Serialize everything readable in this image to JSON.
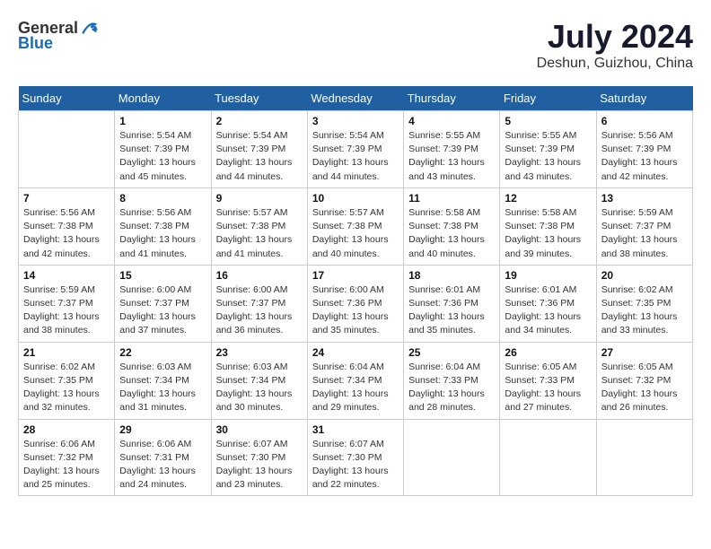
{
  "logo": {
    "text_general": "General",
    "text_blue": "Blue"
  },
  "header": {
    "month_year": "July 2024",
    "location": "Deshun, Guizhou, China"
  },
  "weekdays": [
    "Sunday",
    "Monday",
    "Tuesday",
    "Wednesday",
    "Thursday",
    "Friday",
    "Saturday"
  ],
  "weeks": [
    [
      {
        "day": "",
        "info": ""
      },
      {
        "day": "1",
        "info": "Sunrise: 5:54 AM\nSunset: 7:39 PM\nDaylight: 13 hours\nand 45 minutes."
      },
      {
        "day": "2",
        "info": "Sunrise: 5:54 AM\nSunset: 7:39 PM\nDaylight: 13 hours\nand 44 minutes."
      },
      {
        "day": "3",
        "info": "Sunrise: 5:54 AM\nSunset: 7:39 PM\nDaylight: 13 hours\nand 44 minutes."
      },
      {
        "day": "4",
        "info": "Sunrise: 5:55 AM\nSunset: 7:39 PM\nDaylight: 13 hours\nand 43 minutes."
      },
      {
        "day": "5",
        "info": "Sunrise: 5:55 AM\nSunset: 7:39 PM\nDaylight: 13 hours\nand 43 minutes."
      },
      {
        "day": "6",
        "info": "Sunrise: 5:56 AM\nSunset: 7:39 PM\nDaylight: 13 hours\nand 42 minutes."
      }
    ],
    [
      {
        "day": "7",
        "info": "Sunrise: 5:56 AM\nSunset: 7:38 PM\nDaylight: 13 hours\nand 42 minutes."
      },
      {
        "day": "8",
        "info": "Sunrise: 5:56 AM\nSunset: 7:38 PM\nDaylight: 13 hours\nand 41 minutes."
      },
      {
        "day": "9",
        "info": "Sunrise: 5:57 AM\nSunset: 7:38 PM\nDaylight: 13 hours\nand 41 minutes."
      },
      {
        "day": "10",
        "info": "Sunrise: 5:57 AM\nSunset: 7:38 PM\nDaylight: 13 hours\nand 40 minutes."
      },
      {
        "day": "11",
        "info": "Sunrise: 5:58 AM\nSunset: 7:38 PM\nDaylight: 13 hours\nand 40 minutes."
      },
      {
        "day": "12",
        "info": "Sunrise: 5:58 AM\nSunset: 7:38 PM\nDaylight: 13 hours\nand 39 minutes."
      },
      {
        "day": "13",
        "info": "Sunrise: 5:59 AM\nSunset: 7:37 PM\nDaylight: 13 hours\nand 38 minutes."
      }
    ],
    [
      {
        "day": "14",
        "info": "Sunrise: 5:59 AM\nSunset: 7:37 PM\nDaylight: 13 hours\nand 38 minutes."
      },
      {
        "day": "15",
        "info": "Sunrise: 6:00 AM\nSunset: 7:37 PM\nDaylight: 13 hours\nand 37 minutes."
      },
      {
        "day": "16",
        "info": "Sunrise: 6:00 AM\nSunset: 7:37 PM\nDaylight: 13 hours\nand 36 minutes."
      },
      {
        "day": "17",
        "info": "Sunrise: 6:00 AM\nSunset: 7:36 PM\nDaylight: 13 hours\nand 35 minutes."
      },
      {
        "day": "18",
        "info": "Sunrise: 6:01 AM\nSunset: 7:36 PM\nDaylight: 13 hours\nand 35 minutes."
      },
      {
        "day": "19",
        "info": "Sunrise: 6:01 AM\nSunset: 7:36 PM\nDaylight: 13 hours\nand 34 minutes."
      },
      {
        "day": "20",
        "info": "Sunrise: 6:02 AM\nSunset: 7:35 PM\nDaylight: 13 hours\nand 33 minutes."
      }
    ],
    [
      {
        "day": "21",
        "info": "Sunrise: 6:02 AM\nSunset: 7:35 PM\nDaylight: 13 hours\nand 32 minutes."
      },
      {
        "day": "22",
        "info": "Sunrise: 6:03 AM\nSunset: 7:34 PM\nDaylight: 13 hours\nand 31 minutes."
      },
      {
        "day": "23",
        "info": "Sunrise: 6:03 AM\nSunset: 7:34 PM\nDaylight: 13 hours\nand 30 minutes."
      },
      {
        "day": "24",
        "info": "Sunrise: 6:04 AM\nSunset: 7:34 PM\nDaylight: 13 hours\nand 29 minutes."
      },
      {
        "day": "25",
        "info": "Sunrise: 6:04 AM\nSunset: 7:33 PM\nDaylight: 13 hours\nand 28 minutes."
      },
      {
        "day": "26",
        "info": "Sunrise: 6:05 AM\nSunset: 7:33 PM\nDaylight: 13 hours\nand 27 minutes."
      },
      {
        "day": "27",
        "info": "Sunrise: 6:05 AM\nSunset: 7:32 PM\nDaylight: 13 hours\nand 26 minutes."
      }
    ],
    [
      {
        "day": "28",
        "info": "Sunrise: 6:06 AM\nSunset: 7:32 PM\nDaylight: 13 hours\nand 25 minutes."
      },
      {
        "day": "29",
        "info": "Sunrise: 6:06 AM\nSunset: 7:31 PM\nDaylight: 13 hours\nand 24 minutes."
      },
      {
        "day": "30",
        "info": "Sunrise: 6:07 AM\nSunset: 7:30 PM\nDaylight: 13 hours\nand 23 minutes."
      },
      {
        "day": "31",
        "info": "Sunrise: 6:07 AM\nSunset: 7:30 PM\nDaylight: 13 hours\nand 22 minutes."
      },
      {
        "day": "",
        "info": ""
      },
      {
        "day": "",
        "info": ""
      },
      {
        "day": "",
        "info": ""
      }
    ]
  ]
}
